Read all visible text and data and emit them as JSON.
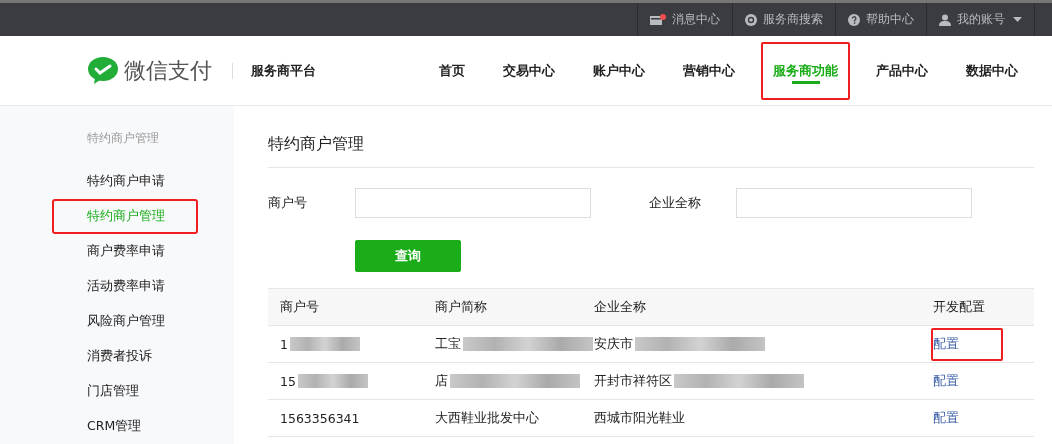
{
  "top_bar": {
    "items": [
      {
        "label": "消息中心",
        "kind": "message"
      },
      {
        "label": "服务商搜索",
        "kind": "search"
      },
      {
        "label": "帮助中心",
        "kind": "help"
      },
      {
        "label": "我的账号",
        "kind": "account"
      }
    ]
  },
  "header": {
    "logo": "微信支付",
    "platform": "服务商平台",
    "nav": [
      {
        "label": "首页",
        "selected": false,
        "annotated": false
      },
      {
        "label": "交易中心",
        "selected": false,
        "annotated": false
      },
      {
        "label": "账户中心",
        "selected": false,
        "annotated": false
      },
      {
        "label": "营销中心",
        "selected": false,
        "annotated": false
      },
      {
        "label": "服务商功能",
        "selected": true,
        "annotated": true
      },
      {
        "label": "产品中心",
        "selected": false,
        "annotated": false
      },
      {
        "label": "数据中心",
        "selected": false,
        "annotated": false
      }
    ]
  },
  "sidebar": {
    "heading": "特约商户管理",
    "items": [
      {
        "label": "特约商户申请",
        "selected": false,
        "annotated": false
      },
      {
        "label": "特约商户管理",
        "selected": true,
        "annotated": true
      },
      {
        "label": "商户费率申请",
        "selected": false,
        "annotated": false
      },
      {
        "label": "活动费率申请",
        "selected": false,
        "annotated": false
      },
      {
        "label": "风险商户管理",
        "selected": false,
        "annotated": false
      },
      {
        "label": "消费者投诉",
        "selected": false,
        "annotated": false
      },
      {
        "label": "门店管理",
        "selected": false,
        "annotated": false
      },
      {
        "label": "CRM管理",
        "selected": false,
        "annotated": false
      }
    ]
  },
  "page_title": "特约商户管理",
  "form": {
    "fields": [
      {
        "label": "商户号"
      },
      {
        "label": "企业全称"
      }
    ],
    "button": "查询"
  },
  "table": {
    "columns": [
      "商户号",
      "商户简称",
      "企业全称",
      "开发配置"
    ],
    "rows": [
      {
        "cells": [
          {
            "text": "1",
            "redacted": true
          },
          {
            "text": "工宝",
            "redacted": true
          },
          {
            "text": "安庆市",
            "redacted": true
          }
        ],
        "action": "配置",
        "annotated": true
      },
      {
        "cells": [
          {
            "text": "15",
            "redacted": true
          },
          {
            "text": "店",
            "redacted": true
          },
          {
            "text": "开封市祥符区",
            "redacted": true
          }
        ],
        "action": "配置",
        "annotated": false
      },
      {
        "cells": [
          {
            "text": "1563356341",
            "redacted": false
          },
          {
            "text": "大西鞋业批发中心",
            "redacted": false
          },
          {
            "text": "西城市阳光鞋业",
            "redacted": false
          }
        ],
        "action": "配置",
        "annotated": false
      }
    ]
  }
}
